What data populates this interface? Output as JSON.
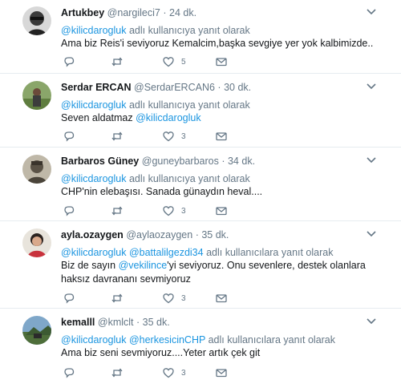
{
  "reply_prefix": "adlı kullanıcıya yanıt olarak",
  "reply_prefix_plural": "adlı kullanıcılara yanıt olarak",
  "tweets": [
    {
      "name": "Artukbey",
      "handle": "@nargileci7",
      "time": "24 dk.",
      "mentions": [
        "@kilicdarogluk"
      ],
      "reply_suffix": "adlı kullanıcıya yanıt olarak",
      "text": "Ama biz Reis'i seviyoruz Kemalcim,başka sevgiye yer yok kalbimizde..",
      "likes": "5"
    },
    {
      "name": "Serdar ERCAN",
      "handle": "@SerdarERCAN6",
      "time": "30 dk.",
      "mentions": [
        "@kilicdarogluk"
      ],
      "reply_suffix": "adlı kullanıcıya yanıt olarak",
      "text_plain": "Seven aldatmaz ",
      "text_mention": "@kilicdarogluk",
      "likes": "3"
    },
    {
      "name": "Barbaros Güney",
      "handle": "@guneybarbaros",
      "time": "34 dk.",
      "mentions": [
        "@kilicdarogluk"
      ],
      "reply_suffix": "adlı kullanıcıya yanıt olarak",
      "text": "CHP'nin elebaşısı. Sanada günaydın heval....",
      "likes": "3"
    },
    {
      "name": "ayla.ozaygen",
      "handle": "@aylaozaygen",
      "time": "35 dk.",
      "mentions": [
        "@kilicdarogluk",
        "@battalilgezdi34"
      ],
      "reply_suffix": "adlı kullanıcılara yanıt olarak",
      "text_pre": "Biz de sayın ",
      "text_mention": "@vekilince",
      "text_post": "'yi  seviyoruz. Onu sevenlere, destek olanlara haksız davrananı sevmiyoruz",
      "likes": "3"
    },
    {
      "name": "kemalll",
      "handle": "@kmlclt",
      "time": "35 dk.",
      "mentions": [
        "@kilicdarogluk",
        "@herkesicinCHP"
      ],
      "reply_suffix": "adlı kullanıcılara yanıt olarak",
      "text": "Ama biz seni sevmiyoruz....Yeter artık çek git",
      "likes": "3"
    }
  ],
  "icons": {
    "reply": "reply-icon",
    "retweet": "retweet-icon",
    "like": "heart-icon",
    "dm": "envelope-icon",
    "more": "chevron-down-icon"
  },
  "colors": {
    "link": "#1b95e0",
    "muted": "#657786",
    "text": "#14171a",
    "divider": "#e6ecf0"
  }
}
